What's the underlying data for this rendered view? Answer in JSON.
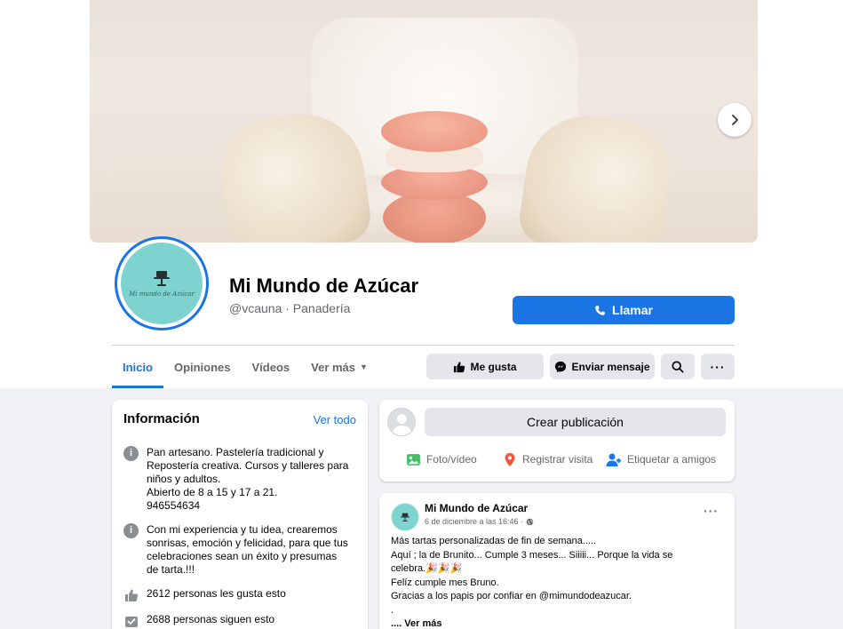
{
  "page": {
    "name": "Mi Mundo de Azúcar",
    "subtitle": "@vcauna · Panadería",
    "avatar_text": "Mi mundo de Azúcar",
    "call_label": "Llamar"
  },
  "tabs": [
    {
      "label": "Inicio",
      "active": true
    },
    {
      "label": "Opiniones"
    },
    {
      "label": "Vídeos"
    },
    {
      "label": "Ver más"
    }
  ],
  "actions": {
    "like_label": "Me gusta",
    "message_label": "Enviar mensaje"
  },
  "info": {
    "title": "Información",
    "see_all": "Ver todo",
    "rows": [
      {
        "icon": "info-icon",
        "text": "Pan artesano. Pastelería tradicional y\nRepostería creativa. Cursos y talleres para\nniños y adultos.\nAbierto de 8 a 15 y 17 a 21.\n946554634"
      },
      {
        "icon": "info-icon",
        "text": "Con mi experiencia y tu idea, crearemos\nsonrisas, emoción y felicidad, para que tus\ncelebraciones sean un éxito y presumas\nde tarta.!!!"
      },
      {
        "icon": "thumbs-up-icon",
        "text": "2612 personas les gusta esto"
      },
      {
        "icon": "follow-icon",
        "text": "2688 personas siguen esto"
      }
    ]
  },
  "composer": {
    "placeholder": "Crear publicación",
    "options": [
      {
        "icon": "photo-icon",
        "label": "Foto/vídeo",
        "color": "#45bd62"
      },
      {
        "icon": "location-pin-icon",
        "label": "Registrar visita",
        "color": "#f5533d"
      },
      {
        "icon": "tag-friends-icon",
        "label": "Etiquetar a amigos",
        "color": "#1877f2"
      }
    ]
  },
  "post": {
    "author": "Mi Mundo de Azúcar",
    "date": "6 de diciembre a las 16:46 ·",
    "text": "Más tartas personalizadas de fin de semana.....\nAquí ; la de Brunito... Cumple 3 meses... Siiiii... Porque la vida se\ncelebra.🎉🎉🎉\nFelíz cumple mes Bruno.\nGracias a los papis por confiar en @mimundodeazucar.\n.",
    "see_more": ".... Ver más"
  },
  "colors": {
    "accent": "#1b74e4",
    "background": "#f0f2f5",
    "avatar_bg": "#7fd3cf"
  }
}
